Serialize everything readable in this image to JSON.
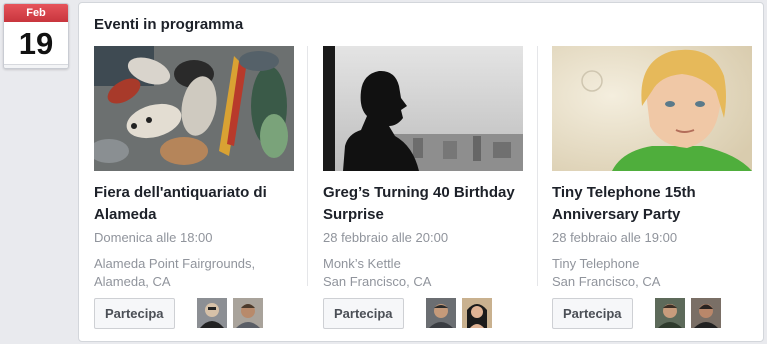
{
  "calendar": {
    "month": "Feb",
    "day": "19"
  },
  "section_title": "Eventi in programma",
  "events": [
    {
      "name": "Fiera dell'antiquariato di Alameda",
      "time": "Domenica alle 18:00",
      "place_line1": "Alameda Point Fairgrounds,",
      "place_line2": "Alameda, CA",
      "join_label": "Partecipa"
    },
    {
      "name": "Greg’s Turning 40 Birthday Surprise",
      "time": "28 febbraio alle 20:00",
      "place_line1": "Monk’s Kettle",
      "place_line2": "San Francisco, CA",
      "join_label": "Partecipa"
    },
    {
      "name": "Tiny Telephone 15th Anniversary Party",
      "time": "28 febbraio alle 19:00",
      "place_line1": "Tiny Telephone",
      "place_line2": "San Francisco, CA",
      "join_label": "Partecipa"
    }
  ]
}
